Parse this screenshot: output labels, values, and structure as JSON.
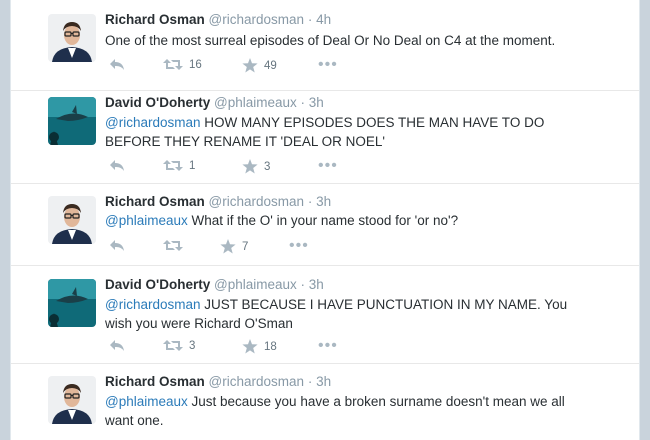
{
  "tweets": [
    {
      "name": "Richard Osman",
      "handle": "@richardosman",
      "dot": "·",
      "time": "4h",
      "mention": "",
      "text": "One of the most surreal episodes of Deal Or No Deal on C4 at the moment.",
      "text2": "",
      "retweets": "16",
      "favorites": "49",
      "avatar_icon": "person-avatar"
    },
    {
      "name": "David O'Doherty",
      "handle": "@phlaimeaux",
      "dot": "·",
      "time": "3h",
      "mention": "@richardosman",
      "text": " HOW MANY EPISODES DOES THE MAN HAVE TO DO",
      "text2": "BEFORE THEY RENAME IT 'DEAL OR NOEL'",
      "retweets": "1",
      "favorites": "3",
      "avatar_icon": "shark-avatar"
    },
    {
      "name": "Richard Osman",
      "handle": "@richardosman",
      "dot": "·",
      "time": "3h",
      "mention": "@phlaimeaux",
      "text": " What if the O' in your name stood for 'or no'?",
      "text2": "",
      "retweets": "",
      "favorites": "7",
      "avatar_icon": "person-avatar"
    },
    {
      "name": "David O'Doherty",
      "handle": "@phlaimeaux",
      "dot": "·",
      "time": "3h",
      "mention": "@richardosman",
      "text": " JUST BECAUSE I HAVE PUNCTUATION IN MY NAME. You",
      "text2": "wish you were Richard O'Sman",
      "retweets": "3",
      "favorites": "18",
      "avatar_icon": "shark-avatar"
    },
    {
      "name": "Richard Osman",
      "handle": "@richardosman",
      "dot": "·",
      "time": "3h",
      "mention": "@phlaimeaux",
      "text": " Just because you have a broken surname doesn't mean we all",
      "text2": "want one.",
      "retweets": "",
      "favorites": "",
      "avatar_icon": "person-avatar"
    }
  ],
  "ellipsis": "•••",
  "colors": {
    "link": "#2b7bb9",
    "muted": "#8899a6",
    "text": "#292f33",
    "icon": "#aab8c2"
  }
}
